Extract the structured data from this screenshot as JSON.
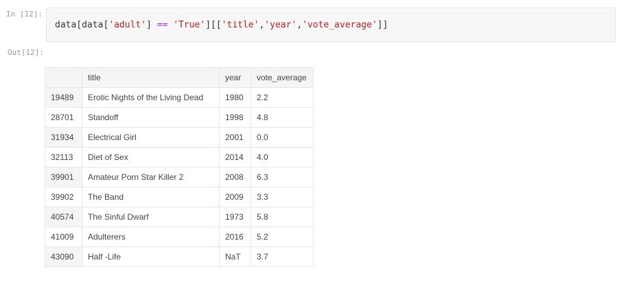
{
  "cell": {
    "in_prompt": "In [12]:",
    "out_prompt": "Out[12]:",
    "code": {
      "t1": "data[data[",
      "t2": "'adult'",
      "t3": "] ",
      "t4": "==",
      "t5": " ",
      "t6": "'True'",
      "t7": "][[",
      "t8": "'title'",
      "t9": ",",
      "t10": "'year'",
      "t11": ",",
      "t12": "'vote_average'",
      "t13": "]]"
    }
  },
  "table": {
    "columns": [
      "",
      "title",
      "year",
      "vote_average"
    ],
    "rows": [
      {
        "index": "19489",
        "title": "Erotic Nights of the Living Dead",
        "year": "1980",
        "vote_average": "2.2"
      },
      {
        "index": "28701",
        "title": "Standoff",
        "year": "1998",
        "vote_average": "4.8"
      },
      {
        "index": "31934",
        "title": "Electrical Girl",
        "year": "2001",
        "vote_average": "0.0"
      },
      {
        "index": "32113",
        "title": "Diet of Sex",
        "year": "2014",
        "vote_average": "4.0"
      },
      {
        "index": "39901",
        "title": "Amateur Porn Star Killer 2",
        "year": "2008",
        "vote_average": "6.3"
      },
      {
        "index": "39902",
        "title": "The Band",
        "year": "2009",
        "vote_average": "3.3"
      },
      {
        "index": "40574",
        "title": "The Sinful Dwarf",
        "year": "1973",
        "vote_average": "5.8"
      },
      {
        "index": "41009",
        "title": "Adulterers",
        "year": "2016",
        "vote_average": "5.2"
      },
      {
        "index": "43090",
        "title": "Half -Life",
        "year": "NaT",
        "vote_average": "3.7"
      }
    ]
  }
}
